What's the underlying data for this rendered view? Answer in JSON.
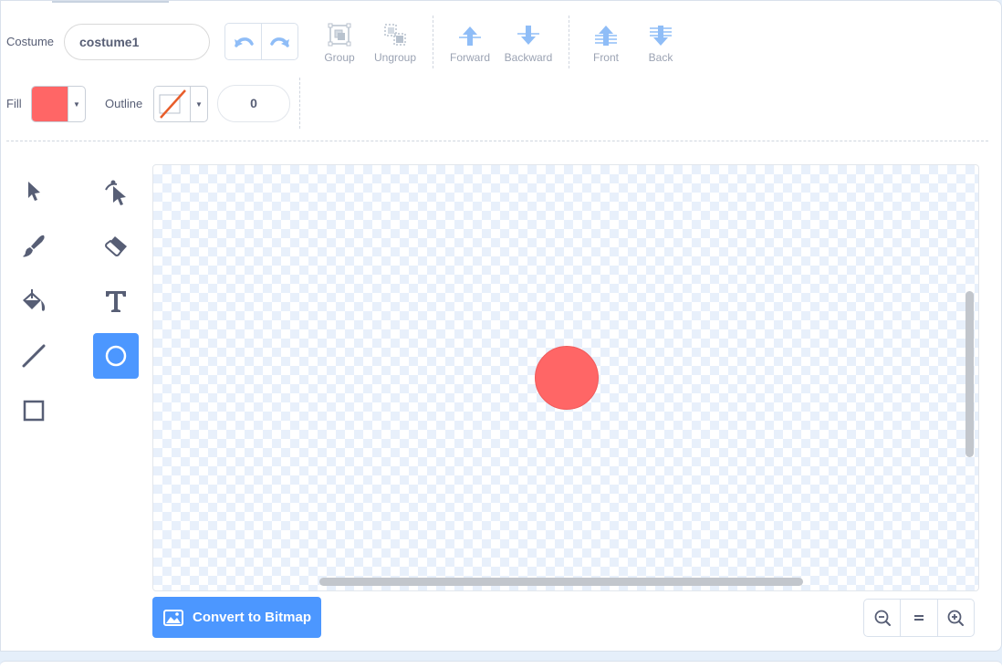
{
  "costume": {
    "label": "Costume",
    "name": "costume1"
  },
  "toolbar": {
    "undo_icon": "undo-icon",
    "redo_icon": "redo-icon",
    "group": "Group",
    "ungroup": "Ungroup",
    "forward": "Forward",
    "backward": "Backward",
    "front": "Front",
    "back": "Back"
  },
  "style": {
    "fill_label": "Fill",
    "fill_color": "#ff6666",
    "outline_label": "Outline",
    "outline_color": "none",
    "outline_width": "0"
  },
  "tools": [
    {
      "name": "select",
      "icon": "select-arrow-icon",
      "active": false
    },
    {
      "name": "reshape",
      "icon": "reshape-icon",
      "active": false
    },
    {
      "name": "brush",
      "icon": "brush-icon",
      "active": false
    },
    {
      "name": "eraser",
      "icon": "eraser-icon",
      "active": false
    },
    {
      "name": "fill",
      "icon": "fill-bucket-icon",
      "active": false
    },
    {
      "name": "text",
      "icon": "text-icon",
      "active": false
    },
    {
      "name": "line",
      "icon": "line-icon",
      "active": false
    },
    {
      "name": "circle",
      "icon": "circle-icon",
      "active": true
    },
    {
      "name": "rectangle",
      "icon": "rectangle-icon",
      "active": false
    }
  ],
  "canvas": {
    "shape": "circle",
    "shape_color": "#ff6666"
  },
  "convert_button": "Convert to Bitmap",
  "zoom": {
    "out_icon": "zoom-out-icon",
    "reset_icon": "zoom-reset-icon",
    "in_icon": "zoom-in-icon"
  },
  "colors": {
    "accent": "#4c97ff",
    "text": "#575e75",
    "muted": "#9ba3b3",
    "icon_blue": "#8fbdf7"
  }
}
